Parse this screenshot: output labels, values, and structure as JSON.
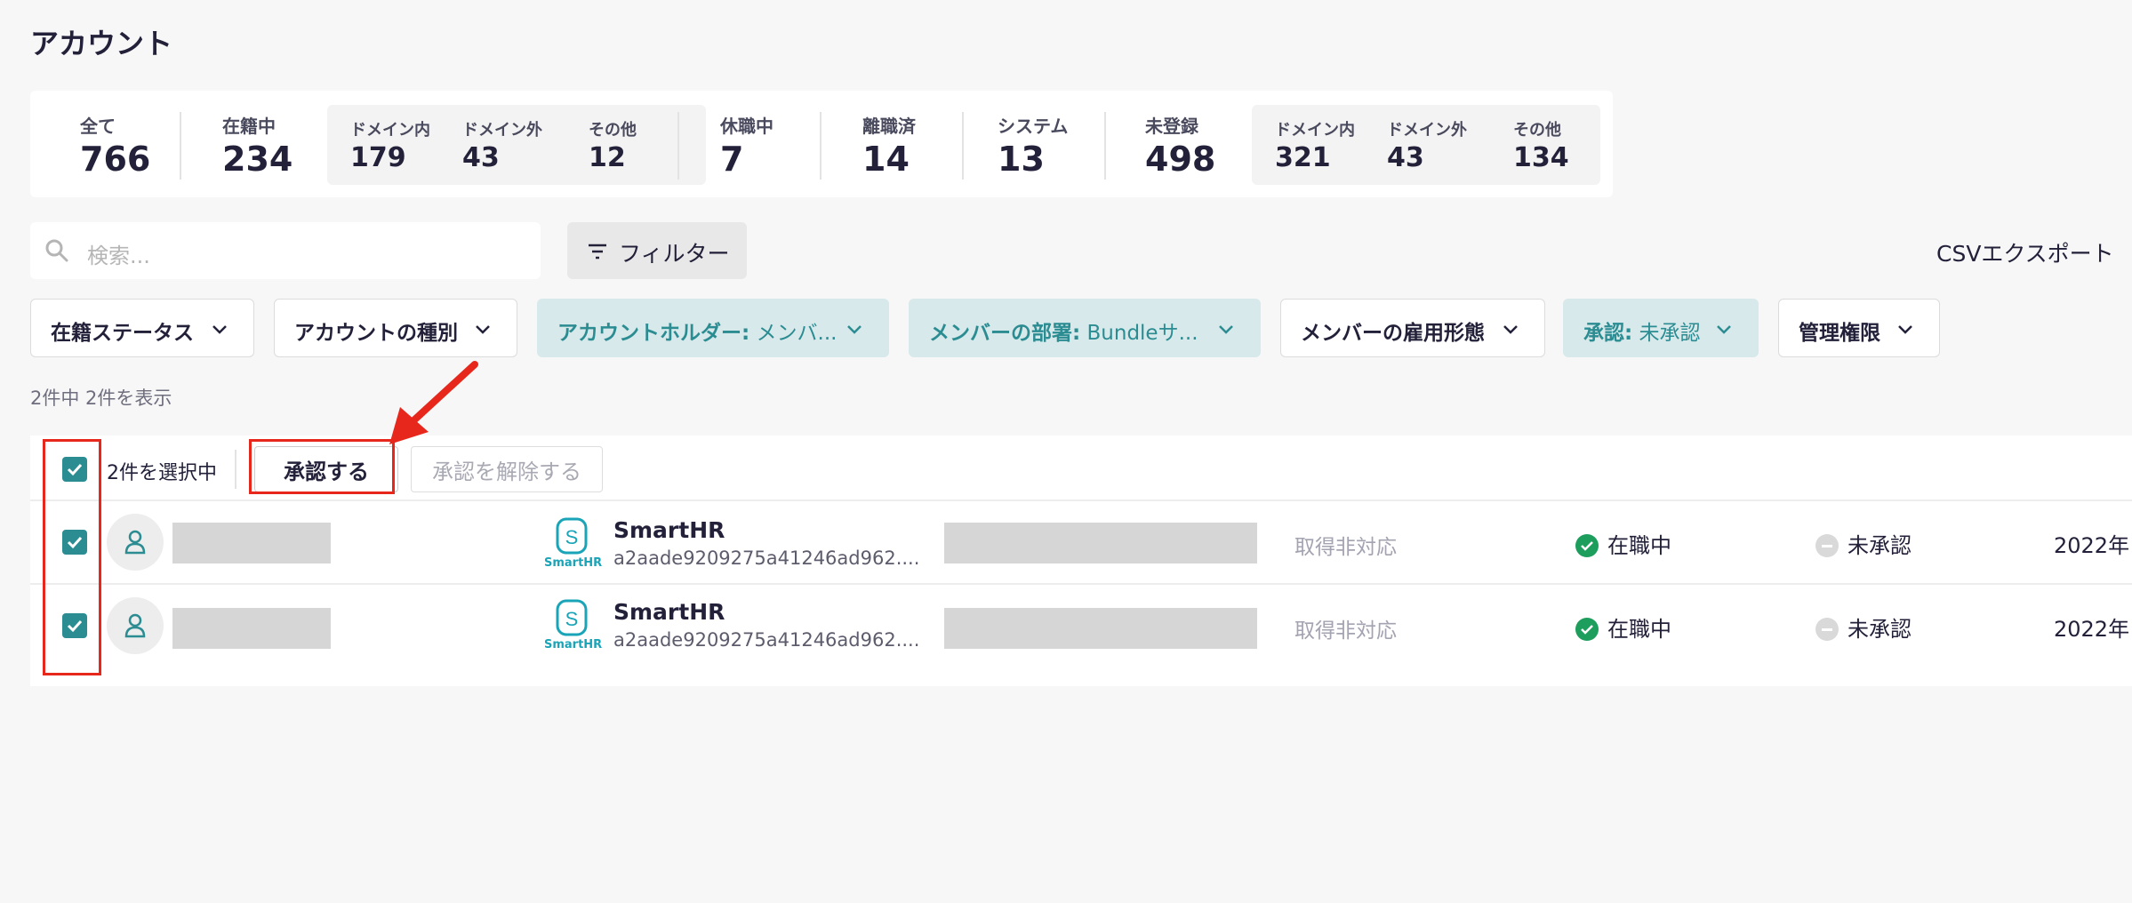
{
  "page_title": "アカウント",
  "stats": {
    "all": {
      "label": "全て",
      "value": "766"
    },
    "enrolled": {
      "label": "在籍中",
      "value": "234"
    },
    "enrolled_domain_in": {
      "label": "ドメイン内",
      "value": "179"
    },
    "enrolled_domain_out": {
      "label": "ドメイン外",
      "value": "43"
    },
    "enrolled_other": {
      "label": "その他",
      "value": "12"
    },
    "on_leave": {
      "label": "休職中",
      "value": "7"
    },
    "retired": {
      "label": "離職済",
      "value": "14"
    },
    "system": {
      "label": "システム",
      "value": "13"
    },
    "unregistered": {
      "label": "未登録",
      "value": "498"
    },
    "unreg_domain_in": {
      "label": "ドメイン内",
      "value": "321"
    },
    "unreg_domain_out": {
      "label": "ドメイン外",
      "value": "43"
    },
    "unreg_other": {
      "label": "その他",
      "value": "134"
    }
  },
  "search": {
    "placeholder": "検索..."
  },
  "filter_button": "フィルター",
  "csv_export": "CSVエクスポート",
  "filters": [
    {
      "label": "在籍ステータス",
      "value": ""
    },
    {
      "label": "アカウントの種別",
      "value": ""
    },
    {
      "label": "アカウントホルダー:",
      "value": " メンバ..."
    },
    {
      "label": "メンバーの部署:",
      "value": " Bundleサ..."
    },
    {
      "label": "メンバーの雇用形態",
      "value": ""
    },
    {
      "label": "承認:",
      "value": " 未承認"
    },
    {
      "label": "管理権限",
      "value": ""
    }
  ],
  "result_count": "2件中 2件を表示",
  "bulk": {
    "selected_text": "2件を選択中",
    "approve": "承認する",
    "unapprove": "承認を解除する"
  },
  "rows": [
    {
      "app_name": "SmartHR",
      "app_logo_text": "SmartHR",
      "app_id": "a2aade9209275a41246ad962....",
      "mfa": "取得非対応",
      "status": "在職中",
      "approval": "未承認",
      "date": "2022年"
    },
    {
      "app_name": "SmartHR",
      "app_logo_text": "SmartHR",
      "app_id": "a2aade9209275a41246ad962....",
      "mfa": "取得非対応",
      "status": "在職中",
      "approval": "未承認",
      "date": "2022年"
    }
  ],
  "colors": {
    "accent": "#2b8c92",
    "annotation": "#e8271c",
    "ok": "#1d9e5c"
  }
}
